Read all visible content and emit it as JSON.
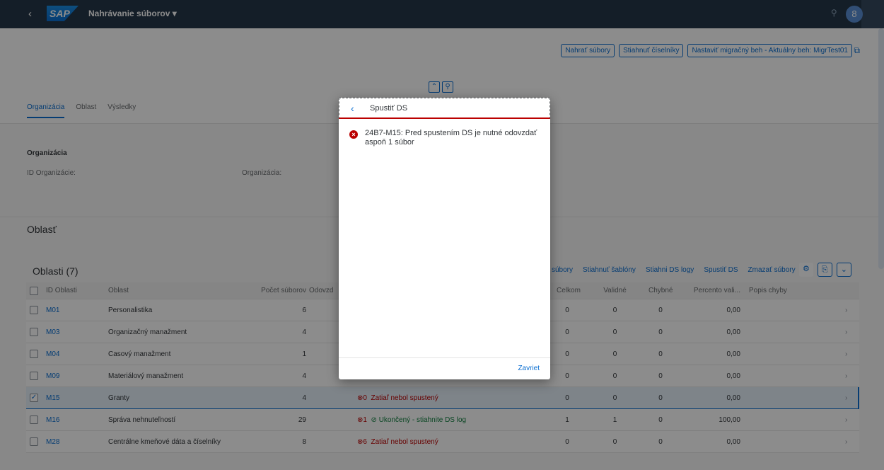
{
  "shell": {
    "back": "‹",
    "logo": "SAP",
    "title": "Nahrávanie súborov ▾",
    "search_icon": "⚲",
    "bell_icon": "♫",
    "avatar": "8"
  },
  "header": {
    "buttons": [
      "Nahrať súbory",
      "Stiahnuť číselníky",
      "Nastaviť migračný beh - Aktuálny beh: MigrTest01"
    ],
    "share": "⧉",
    "collapse": "⌃",
    "pin": "⚲"
  },
  "tabs": [
    "Organizácia",
    "Oblast",
    "Výsledky"
  ],
  "organization": {
    "title": "Organizácia",
    "id_label": "ID Organizácie:",
    "org_label": "Organizácia:"
  },
  "oblast_section": "Oblasť",
  "table": {
    "title": "Oblasti (7)",
    "toolbar": [
      "súbory",
      "Stiahnuť šablóny",
      "Stiahni DS logy",
      "Spustiť DS",
      "Zmazať súbory"
    ],
    "gear": "⚙",
    "export": "⎘",
    "dropdown": "⌄",
    "columns": {
      "id": "ID Oblasti",
      "oblast": "Oblast",
      "pocet": "Počet súborov",
      "odv": "Odovzd",
      "celkom": "Celkom",
      "validne": "Validné",
      "chybne": "Chybné",
      "percento": "Percento vali...",
      "popis": "Popis chyby"
    },
    "rows": [
      {
        "id": "M01",
        "oblast": "Personalistika",
        "pocet": "6",
        "status_num": "",
        "status": "",
        "celkom": "0",
        "validne": "0",
        "chybne": "0",
        "percento": "0,00",
        "sel": false
      },
      {
        "id": "M03",
        "oblast": "Organizačný manažment",
        "pocet": "4",
        "status_num": "",
        "status": "",
        "celkom": "0",
        "validne": "0",
        "chybne": "0",
        "percento": "0,00",
        "sel": false
      },
      {
        "id": "M04",
        "oblast": "Casový manažment",
        "pocet": "1",
        "status_num": "",
        "status": "",
        "celkom": "0",
        "validne": "0",
        "chybne": "0",
        "percento": "0,00",
        "sel": false
      },
      {
        "id": "M09",
        "oblast": "Materiálový manažment",
        "pocet": "4",
        "status_num": "",
        "status": "",
        "celkom": "0",
        "validne": "0",
        "chybne": "0",
        "percento": "0,00",
        "sel": false
      },
      {
        "id": "M15",
        "oblast": "Granty",
        "pocet": "4",
        "status_num": "0",
        "status": "Zatiaľ nebol spustený",
        "celkom": "0",
        "validne": "0",
        "chybne": "0",
        "percento": "0,00",
        "sel": true
      },
      {
        "id": "M16",
        "oblast": "Správa nehnuteľností",
        "pocet": "29",
        "status_num": "1",
        "status": "Ukončený - stiahnite DS log",
        "celkom": "1",
        "validne": "1",
        "chybne": "0",
        "percento": "100,00",
        "sel": false
      },
      {
        "id": "M28",
        "oblast": "Centrálne kmeňové dáta a číselníky",
        "pocet": "8",
        "status_num": "6",
        "status": "Zatiaľ nebol spustený",
        "celkom": "0",
        "validne": "0",
        "chybne": "0",
        "percento": "0,00",
        "sel": false
      }
    ]
  },
  "dialog": {
    "title": "Spustiť DS",
    "message": "24B7-M15: Pred spustením DS je nutné odovzdať aspoň 1 súbor",
    "close": "Zavriet"
  }
}
